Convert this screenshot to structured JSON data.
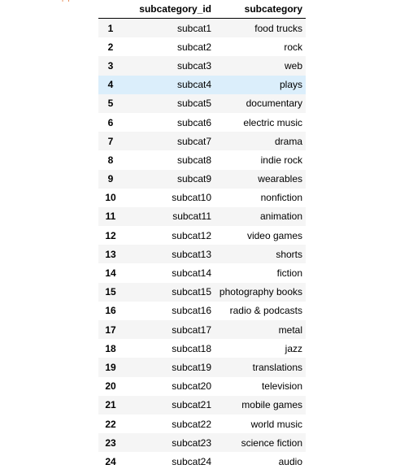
{
  "table": {
    "columns": [
      "",
      "subcategory_id",
      "subcategory"
    ],
    "hover_row_index": 3,
    "colors": {
      "stripe": "#f5f5f5",
      "hover": "#dbeefb",
      "header_border": "#000000"
    },
    "rows": [
      {
        "idx": "1",
        "id": "subcat1",
        "name": "food trucks"
      },
      {
        "idx": "2",
        "id": "subcat2",
        "name": "rock"
      },
      {
        "idx": "3",
        "id": "subcat3",
        "name": "web"
      },
      {
        "idx": "4",
        "id": "subcat4",
        "name": "plays"
      },
      {
        "idx": "5",
        "id": "subcat5",
        "name": "documentary"
      },
      {
        "idx": "6",
        "id": "subcat6",
        "name": "electric music"
      },
      {
        "idx": "7",
        "id": "subcat7",
        "name": "drama"
      },
      {
        "idx": "8",
        "id": "subcat8",
        "name": "indie rock"
      },
      {
        "idx": "9",
        "id": "subcat9",
        "name": "wearables"
      },
      {
        "idx": "10",
        "id": "subcat10",
        "name": "nonfiction"
      },
      {
        "idx": "11",
        "id": "subcat11",
        "name": "animation"
      },
      {
        "idx": "12",
        "id": "subcat12",
        "name": "video games"
      },
      {
        "idx": "13",
        "id": "subcat13",
        "name": "shorts"
      },
      {
        "idx": "14",
        "id": "subcat14",
        "name": "fiction"
      },
      {
        "idx": "15",
        "id": "subcat15",
        "name": "photography books"
      },
      {
        "idx": "16",
        "id": "subcat16",
        "name": "radio & podcasts"
      },
      {
        "idx": "17",
        "id": "subcat17",
        "name": "metal"
      },
      {
        "idx": "18",
        "id": "subcat18",
        "name": "jazz"
      },
      {
        "idx": "19",
        "id": "subcat19",
        "name": "translations"
      },
      {
        "idx": "20",
        "id": "subcat20",
        "name": "television"
      },
      {
        "idx": "21",
        "id": "subcat21",
        "name": "mobile games"
      },
      {
        "idx": "22",
        "id": "subcat22",
        "name": "world music"
      },
      {
        "idx": "23",
        "id": "subcat23",
        "name": "science fiction"
      },
      {
        "idx": "24",
        "id": "subcat24",
        "name": "audio"
      }
    ]
  }
}
